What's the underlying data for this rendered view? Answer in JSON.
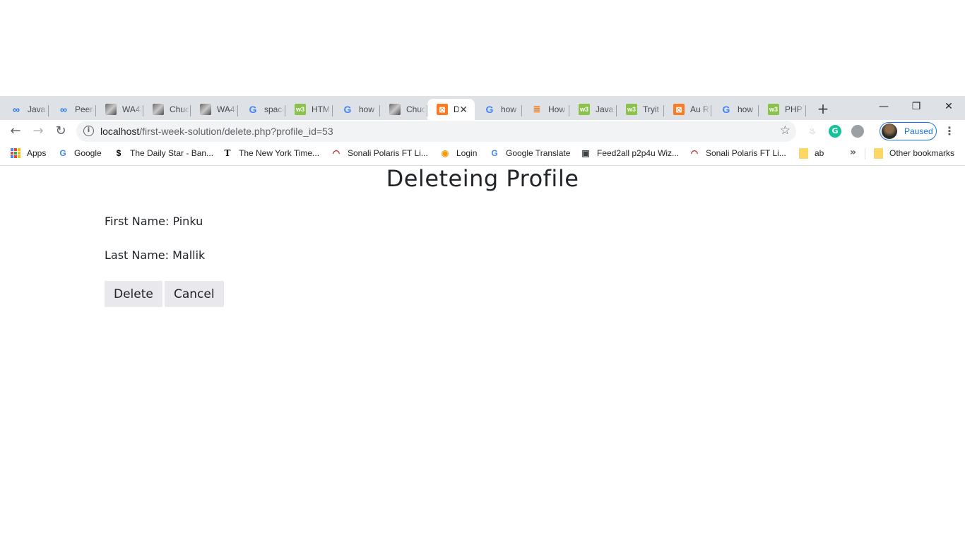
{
  "tabs": [
    {
      "label": "JavaS",
      "icon": "infinity-icon",
      "glyph": "∞"
    },
    {
      "label": "Peer-",
      "icon": "infinity-icon",
      "glyph": "∞"
    },
    {
      "label": "WA4E",
      "icon": "photo-icon",
      "glyph": ""
    },
    {
      "label": "Chuc",
      "icon": "photo-icon",
      "glyph": ""
    },
    {
      "label": "WA4E",
      "icon": "photo-icon",
      "glyph": ""
    },
    {
      "label": "space",
      "icon": "google-icon",
      "glyph": "G"
    },
    {
      "label": "HTM",
      "icon": "w3schools-icon",
      "glyph": "w3"
    },
    {
      "label": "how",
      "icon": "google-icon",
      "glyph": "G"
    },
    {
      "label": "Chuc",
      "icon": "photo-icon",
      "glyph": ""
    },
    {
      "label": "D",
      "icon": "xampp-icon",
      "glyph": "⊠",
      "active": true
    },
    {
      "label": "how",
      "icon": "google-icon",
      "glyph": "G"
    },
    {
      "label": "How",
      "icon": "stackoverflow-icon",
      "glyph": "≣"
    },
    {
      "label": "JavaS",
      "icon": "w3schools-icon",
      "glyph": "w3"
    },
    {
      "label": "Tryit",
      "icon": "w3schools-icon",
      "glyph": "w3"
    },
    {
      "label": "Au R",
      "icon": "xampp-icon",
      "glyph": "⊠"
    },
    {
      "label": "how",
      "icon": "google-icon",
      "glyph": "G"
    },
    {
      "label": "PHP",
      "icon": "w3schools-icon",
      "glyph": "w3"
    }
  ],
  "browser": {
    "url_host": "localhost",
    "url_path": "/first-week-solution/delete.php?profile_id=53",
    "profile_status": "Paused",
    "new_tab_glyph": "+",
    "minimize_glyph": "—",
    "restore_glyph": "❐",
    "close_glyph": "✕",
    "tab_close_glyph": "✕"
  },
  "bookmarks": [
    {
      "label": "Apps",
      "icon": "apps-grid-icon"
    },
    {
      "label": "Google",
      "icon": "google-icon"
    },
    {
      "label": "The Daily Star - Ban...",
      "icon": "daily-star-icon"
    },
    {
      "label": "The New York Time...",
      "icon": "nyt-icon"
    },
    {
      "label": "Sonali Polaris FT Li...",
      "icon": "sonali-icon"
    },
    {
      "label": "Login",
      "icon": "login-icon"
    },
    {
      "label": "Google Translate",
      "icon": "translate-icon"
    },
    {
      "label": "Feed2all p2p4u Wiz...",
      "icon": "monitor-icon"
    },
    {
      "label": "Sonali Polaris FT Li...",
      "icon": "sonali-icon"
    },
    {
      "label": "ab",
      "icon": "folder-icon"
    },
    {
      "label": "Other bookmarks",
      "icon": "folder-icon"
    }
  ],
  "page": {
    "title": "Deleteing Profile",
    "first_name_line": "First Name: Pinku",
    "last_name_line": "Last Name: Mallik",
    "delete_label": "Delete",
    "cancel_label": "Cancel"
  },
  "colors": {
    "tabstrip": "#dee1e6",
    "accent": "#1a73e8",
    "button_bg": "#e9e9ed"
  }
}
